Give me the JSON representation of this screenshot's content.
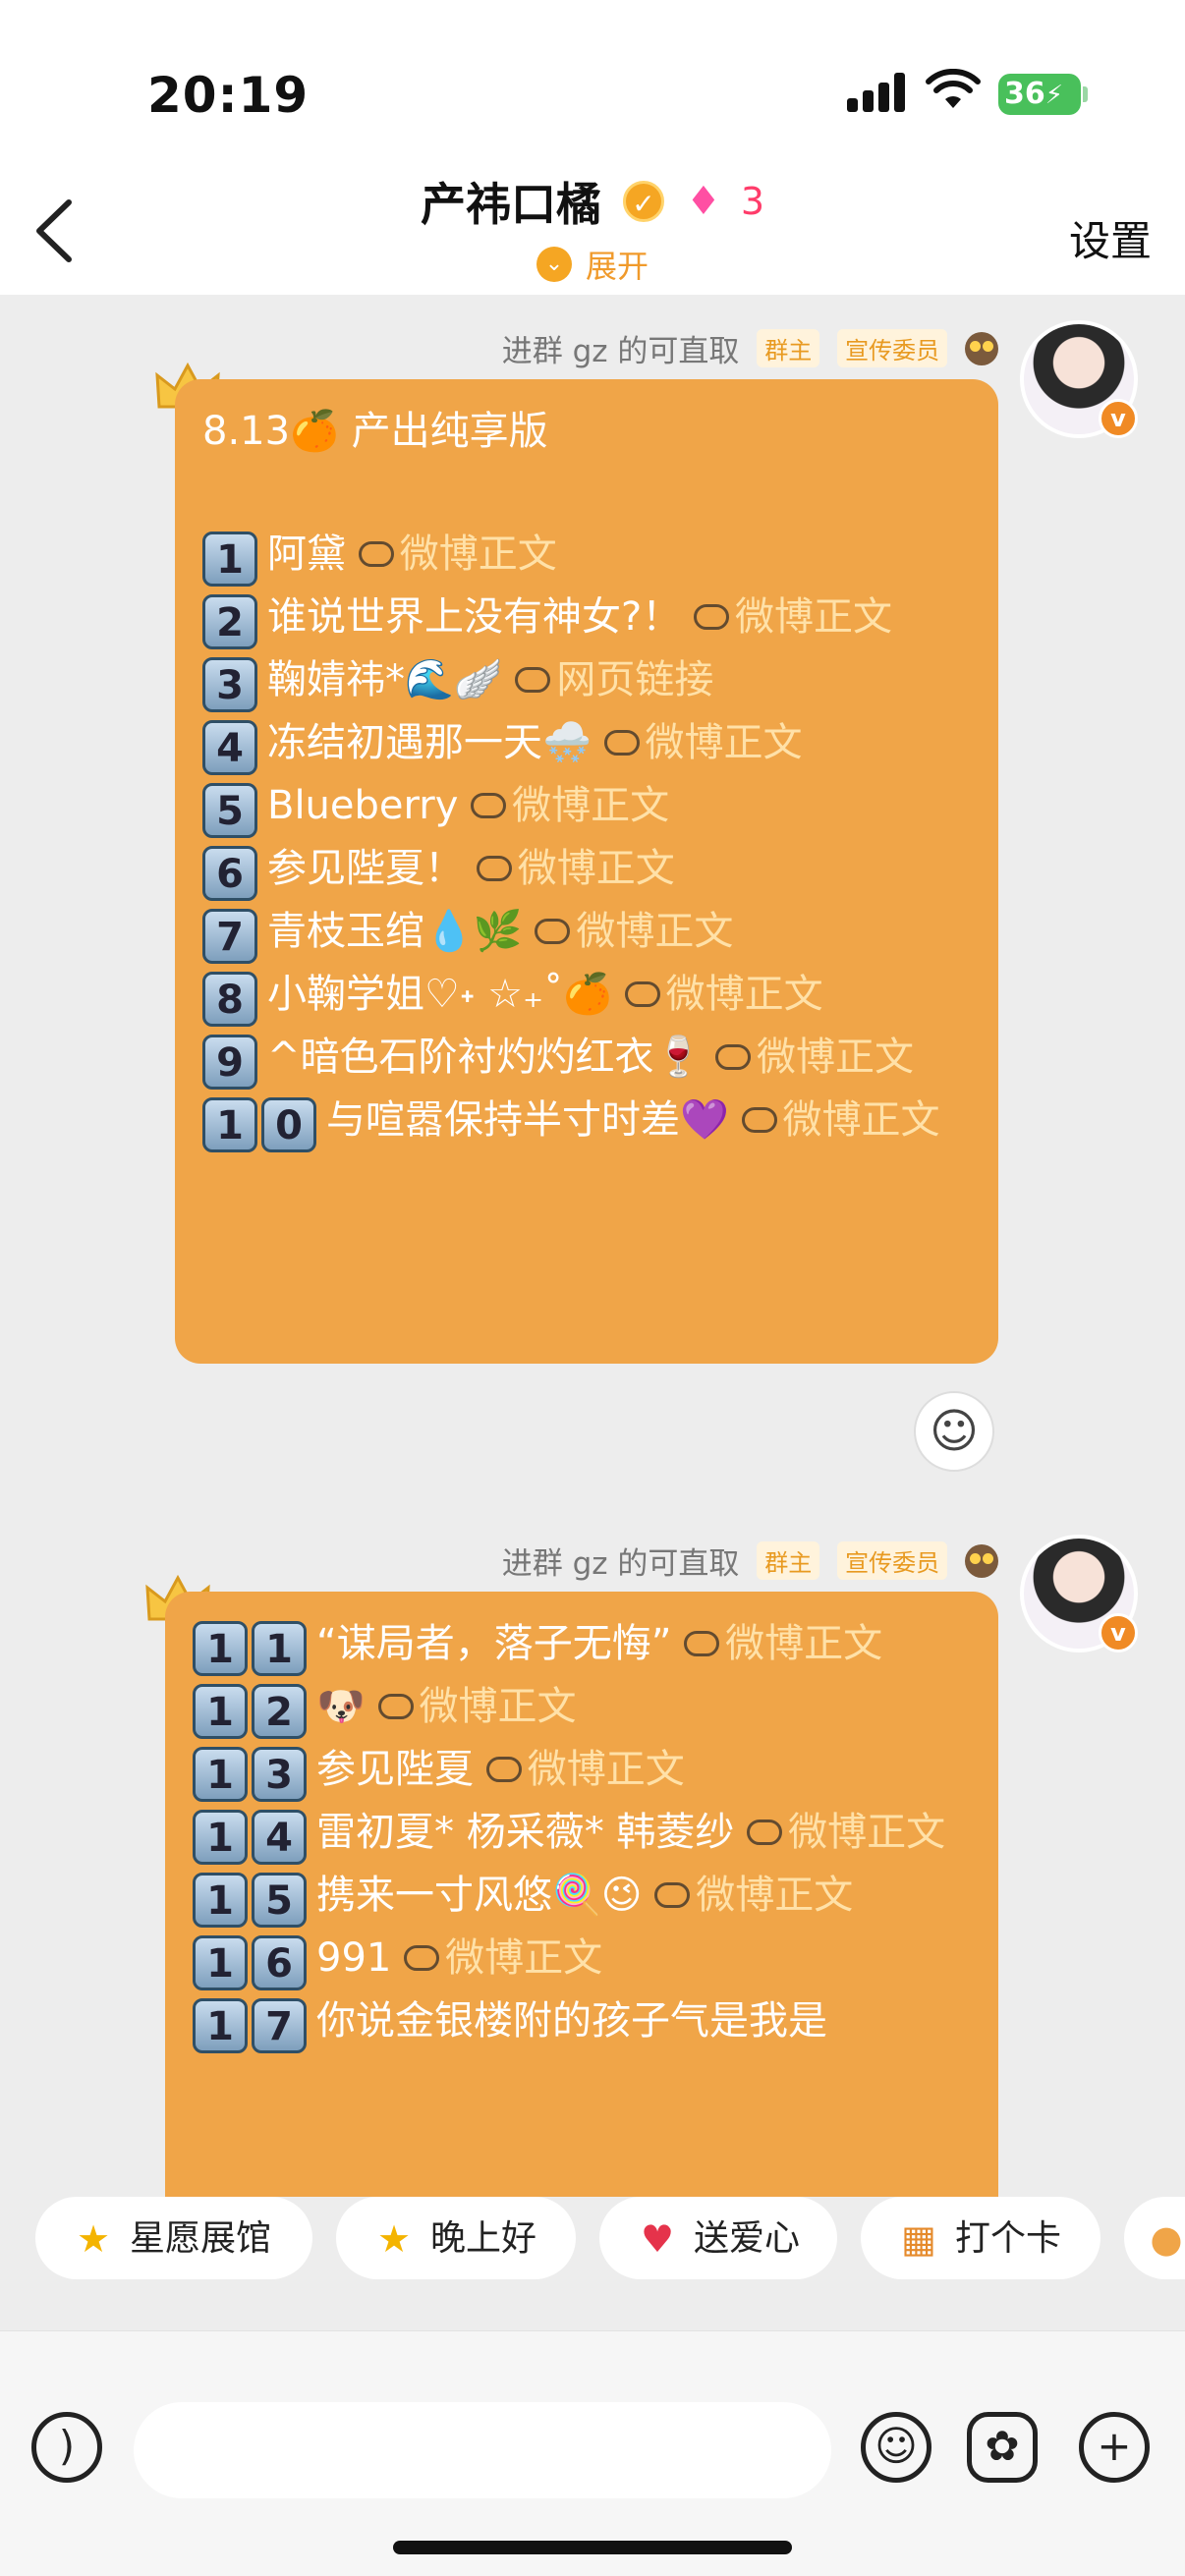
{
  "status": {
    "time": "20:19",
    "battery": "36"
  },
  "header": {
    "title": "产祎口橘",
    "level": "3",
    "expand_label": "展开",
    "settings_label": "设置"
  },
  "messages": [
    {
      "sender": "进群 gz 的可直取",
      "tags": [
        "群主",
        "宣传委员"
      ],
      "title": "8.13🍊 产出纯享版",
      "link_label": "微博正文",
      "items": [
        {
          "num": [
            "1"
          ],
          "text": "阿黛",
          "link": "微博正文"
        },
        {
          "num": [
            "2"
          ],
          "text": "谁说世界上没有神女?！",
          "link": "微博正文"
        },
        {
          "num": [
            "3"
          ],
          "text": "鞠婧祎*🌊🪽",
          "link": "网页链接"
        },
        {
          "num": [
            "4"
          ],
          "text": "冻结初遇那一天🌨️",
          "link": "微博正文"
        },
        {
          "num": [
            "5"
          ],
          "text": "Blueberry",
          "link": "微博正文"
        },
        {
          "num": [
            "6"
          ],
          "text": "参见陛夏！",
          "link": "微博正文"
        },
        {
          "num": [
            "7"
          ],
          "text": "青枝玉绾💧🌿",
          "link": "微博正文"
        },
        {
          "num": [
            "8"
          ],
          "text": "小鞠学姐♡˖ ☆₊˚🍊",
          "link": "微博正文"
        },
        {
          "num": [
            "9"
          ],
          "text": "^暗色石阶衬灼灼红衣🍷",
          "link": "微博正文"
        },
        {
          "num": [
            "1",
            "0"
          ],
          "text": "与喧嚣保持半寸时差💜",
          "link": "微博正文"
        }
      ]
    },
    {
      "sender": "进群 gz 的可直取",
      "tags": [
        "群主",
        "宣传委员"
      ],
      "items": [
        {
          "num": [
            "1",
            "1"
          ],
          "text": "“谋局者，落子无悔”",
          "link": "微博正文"
        },
        {
          "num": [
            "1",
            "2"
          ],
          "text": "🐶",
          "link": "微博正文"
        },
        {
          "num": [
            "1",
            "3"
          ],
          "text": "参见陛夏",
          "link": "微博正文"
        },
        {
          "num": [
            "1",
            "4"
          ],
          "text": "雷初夏* 杨采薇* 韩菱纱",
          "link": "微博正文"
        },
        {
          "num": [
            "1",
            "5"
          ],
          "text": "携来一寸风悠🍭😉",
          "link": "微博正文"
        },
        {
          "num": [
            "1",
            "6"
          ],
          "text": "991",
          "link": "微博正文"
        },
        {
          "num": [
            "1",
            "7"
          ],
          "text": "你说金银楼附的孩子气是我是",
          "link": ""
        }
      ]
    }
  ],
  "chips": [
    {
      "label": "星愿展馆",
      "icon": "star-icon"
    },
    {
      "label": "晚上好",
      "icon": "smile-star-icon"
    },
    {
      "label": "送爱心",
      "icon": "heart-icon"
    },
    {
      "label": "打个卡",
      "icon": "calendar-icon"
    }
  ],
  "colors": {
    "bubble": "#f0a548",
    "link": "#ffe1a8",
    "accent": "#f09a2b"
  }
}
